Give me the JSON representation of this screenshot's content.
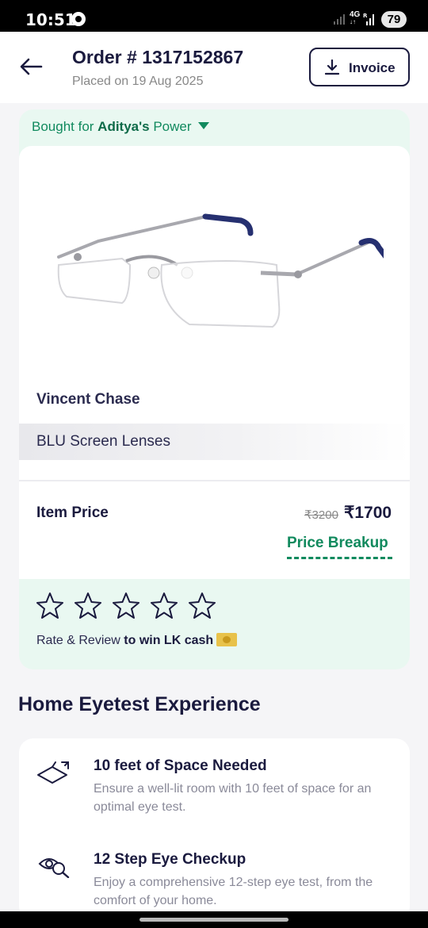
{
  "status_bar": {
    "time": "10:51",
    "network": "4G",
    "network_sub": "R",
    "battery": "79"
  },
  "header": {
    "title": "Order # 1317152867",
    "placed_on": "Placed on 19 Aug 2025",
    "invoice_label": "Invoice",
    "back_icon": "back-arrow-icon",
    "download_icon": "download-icon"
  },
  "product": {
    "bought_for_prefix": "Bought for ",
    "bought_for_name": "Aditya's",
    "bought_for_suffix": " Power",
    "brand": "Vincent Chase",
    "lens": "BLU Screen Lenses",
    "item_price_label": "Item Price",
    "price_old": "₹3200",
    "price_new": "₹1700",
    "price_breakup": "Price Breakup",
    "rating": {
      "stars_filled": 0,
      "stars_total": 5,
      "rate_text": "Rate & Review",
      "rate_bold": " to win LK cash"
    }
  },
  "eyetest": {
    "section_title": "Home Eyetest Experience",
    "items": [
      {
        "icon": "floor-space-icon",
        "title": "10 feet of Space Needed",
        "desc": "Ensure a well-lit room with 10 feet of space for an optimal eye test."
      },
      {
        "icon": "eye-search-icon",
        "title": "12 Step Eye Checkup",
        "desc": "Enjoy a comprehensive 12-step eye test, from the comfort of your home."
      }
    ]
  },
  "colors": {
    "primary_dark": "#1a1a3e",
    "accent_green": "#118a5e",
    "mint_bg": "#e9f8f1"
  }
}
